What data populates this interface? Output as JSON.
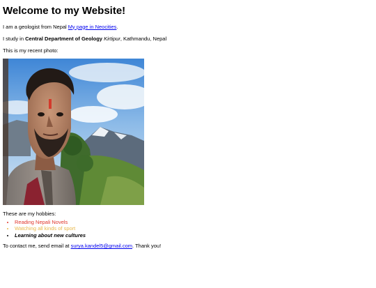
{
  "page": {
    "title": "Welcome to my Website!",
    "intro": {
      "text": "I am a geologist from Nepal ",
      "link_label": "My page in Neocities",
      "suffix": "."
    },
    "study": {
      "prefix": "I study in ",
      "department": "Central Department of Geology",
      "separator": " ",
      "place": "Kirtipur",
      "suffix": ", Kathmandu, Nepal"
    },
    "photo_caption": "This is my recent photo:",
    "hobbies_label": "These are my hobbies:",
    "hobbies": [
      "Reading Nepali Novels",
      "Watching all kinds of sport",
      "Learning about new cultures"
    ],
    "contact": {
      "prefix": "To contact me, send email at ",
      "email": "surya.kandel5@gmail.com",
      "suffix": ". Thank you!"
    }
  },
  "colors": {
    "link": "#0000ee",
    "hobby_1": "#e0362c",
    "hobby_2": "#e8b84a"
  }
}
